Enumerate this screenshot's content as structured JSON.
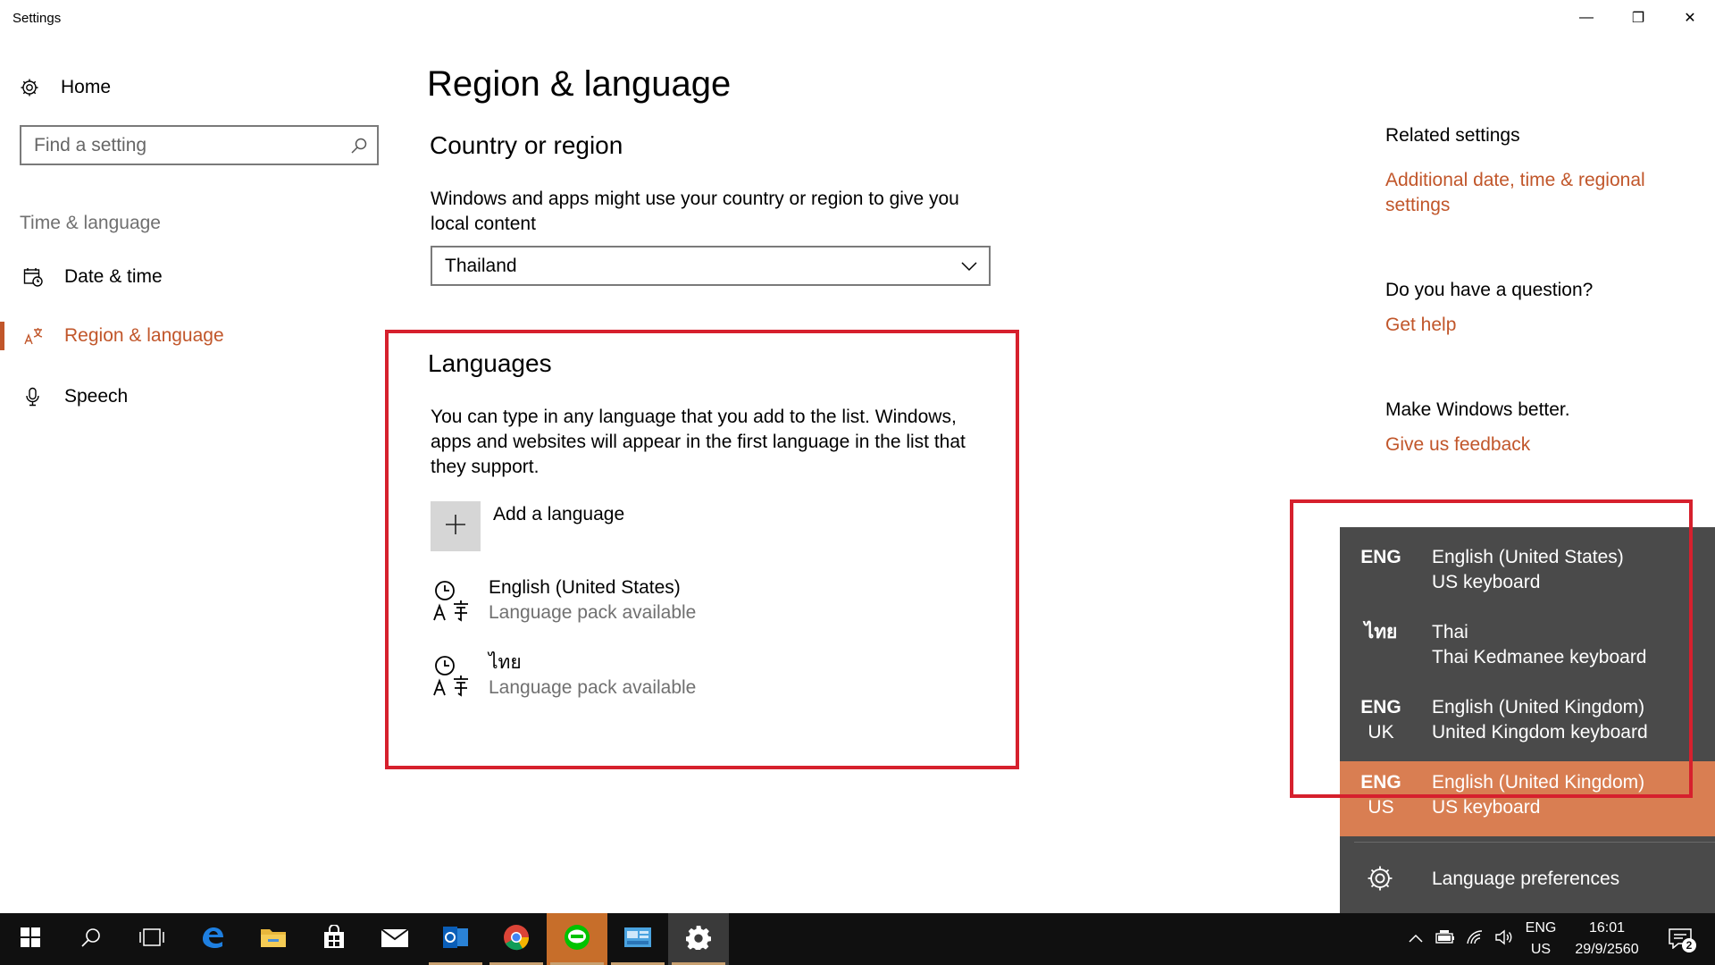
{
  "window": {
    "title": "Settings",
    "minimize_glyph": "—",
    "restore_glyph": "❐",
    "close_glyph": "✕"
  },
  "sidebar": {
    "home_label": "Home",
    "search_placeholder": "Find a setting",
    "section_label": "Time & language",
    "items": [
      {
        "label": "Date & time",
        "icon": "calendar-clock-icon"
      },
      {
        "label": "Region & language",
        "icon": "region-language-icon",
        "active": true
      },
      {
        "label": "Speech",
        "icon": "microphone-icon"
      }
    ]
  },
  "main": {
    "title": "Region & language",
    "country": {
      "heading": "Country or region",
      "description_line1": "Windows and apps might use your country or region to give you",
      "description_line2": "local content",
      "selected": "Thailand"
    },
    "languages": {
      "heading": "Languages",
      "description_line1": "You can type in any language that you add to the list. Windows,",
      "description_line2": "apps and websites will appear in the first language in the list that",
      "description_line3": "they support.",
      "add_label": "Add a language",
      "items": [
        {
          "name": "English (United States)",
          "status": "Language pack available"
        },
        {
          "name": "ไทย",
          "status": "Language pack available"
        }
      ]
    }
  },
  "related": {
    "heading": "Related settings",
    "link_line1": "Additional date, time & regional",
    "link_line2": "settings",
    "question": "Do you have a question?",
    "help_link": "Get help",
    "better": "Make Windows better.",
    "feedback_link": "Give us feedback"
  },
  "flyout": {
    "items": [
      {
        "code1": "ENG",
        "code2": "",
        "line1": "English (United States)",
        "line2": "US keyboard"
      },
      {
        "code1": "ไทย",
        "code2": "",
        "line1": "Thai",
        "line2": "Thai Kedmanee keyboard"
      },
      {
        "code1": "ENG",
        "code2": "UK",
        "line1": "English (United Kingdom)",
        "line2": "United Kingdom keyboard"
      },
      {
        "code1": "ENG",
        "code2": "US",
        "line1": "English (United Kingdom)",
        "line2": "US keyboard",
        "selected": true
      }
    ],
    "preferences_label": "Language preferences"
  },
  "taskbar": {
    "lang_line1": "ENG",
    "lang_line2": "US",
    "time": "16:01",
    "date": "29/9/2560",
    "notification_count": "2",
    "colors": {
      "background": "#101010",
      "accent": "#c1562a",
      "line_app": "#c76e2a"
    }
  }
}
